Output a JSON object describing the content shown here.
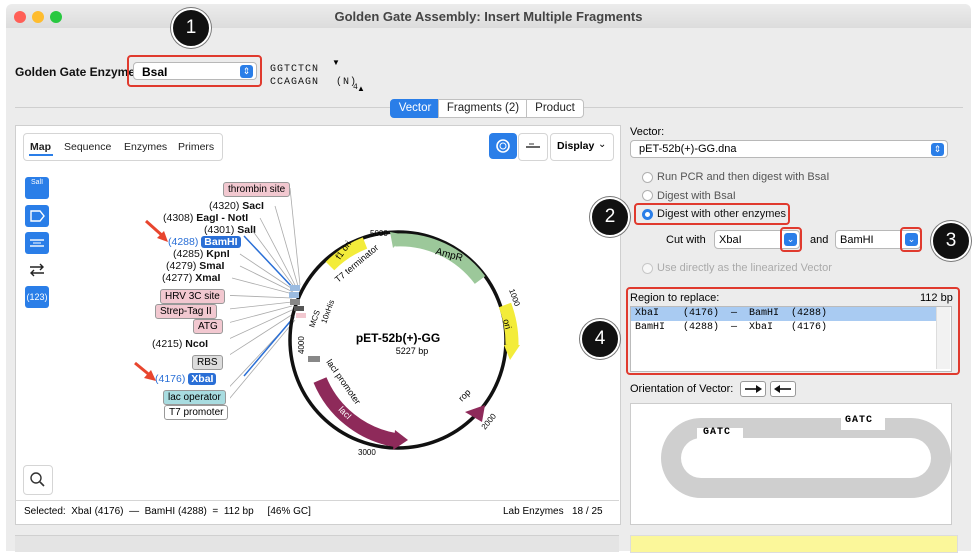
{
  "window": {
    "title": "Golden Gate Assembly: Insert Multiple Fragments"
  },
  "enzyme": {
    "label": "Golden Gate Enzyme:",
    "selected": "BsaI",
    "site_top": "GGTCTCN",
    "site_bottom": "CCAGAGN",
    "site_suffix": "(N)",
    "site_sub": "4"
  },
  "tabs": {
    "vector": "Vector",
    "fragments": "Fragments (2)",
    "product": "Product"
  },
  "map_tabs": {
    "map": "Map",
    "sequence": "Sequence",
    "enzymes": "Enzymes",
    "primers": "Primers",
    "display": "Display"
  },
  "sidebar": {
    "badge": "(123)",
    "sali_top": "SalI"
  },
  "enzymes_list": [
    {
      "pos": "(4320)",
      "name": "SacI",
      "color": "#111111"
    },
    {
      "pos": "(4308)",
      "name": "EagI - NotI",
      "color": "#111111"
    },
    {
      "pos": "(4301)",
      "name": "SalI",
      "color": "#111111"
    },
    {
      "pos": "(4288)",
      "name": "BamHI",
      "color": "#2a6fd6"
    },
    {
      "pos": "(4285)",
      "name": "KpnI",
      "color": "#111111"
    },
    {
      "pos": "(4279)",
      "name": "SmaI",
      "color": "#111111"
    },
    {
      "pos": "(4277)",
      "name": "XmaI",
      "color": "#111111"
    },
    {
      "pos": "(4215)",
      "name": "NcoI",
      "color": "#111111"
    },
    {
      "pos": "(4176)",
      "name": "XbaI",
      "color": "#2a6fd6"
    }
  ],
  "features": {
    "thrombin": "thrombin site",
    "hrv": "HRV 3C site",
    "strep": "Strep-Tag II",
    "atg": "ATG",
    "rbs": "RBS",
    "lacop": "lac operator",
    "t7p": "T7 promoter",
    "f1ori": "f1 ori",
    "t7term": "T7 terminator",
    "ampr": "AmpR",
    "ori": "ori",
    "rop": "rop",
    "laci": "lacI",
    "lacip": "lacI promoter",
    "mcs": "MCS",
    "his": "10xHis"
  },
  "plasmid": {
    "name": "pET-52b(+)-GG",
    "size": "5227 bp",
    "ticks": [
      "5000",
      "1000",
      "2000",
      "3000",
      "4000"
    ]
  },
  "statusbar": {
    "selected": "Selected:  XbaI (4176)  —  BamHI (4288)  =  112 bp     [46% GC]",
    "lab": "Lab Enzymes",
    "count": "18 / 25"
  },
  "vector": {
    "label": "Vector:",
    "file": "pET-52b(+)-GG.dna",
    "opt1": "Run PCR and then digest with BsaI",
    "opt2": "Digest with BsaI",
    "opt3": "Digest with other enzymes",
    "cut_with": "Cut with",
    "enz1": "XbaI",
    "and": "and",
    "enz2": "BamHI",
    "opt4": "Use directly as the linearized Vector"
  },
  "region": {
    "label": "Region to replace:",
    "size": "112 bp",
    "rows": [
      "XbaI    (4176)  —  BamHI  (4288)",
      "BamHI   (4288)  —  XbaI   (4176)"
    ]
  },
  "orientation": {
    "label": "Orientation of Vector:"
  },
  "overhangs": {
    "left": "GATC",
    "right": "GATC"
  },
  "callouts": [
    "1",
    "2",
    "3",
    "4"
  ]
}
